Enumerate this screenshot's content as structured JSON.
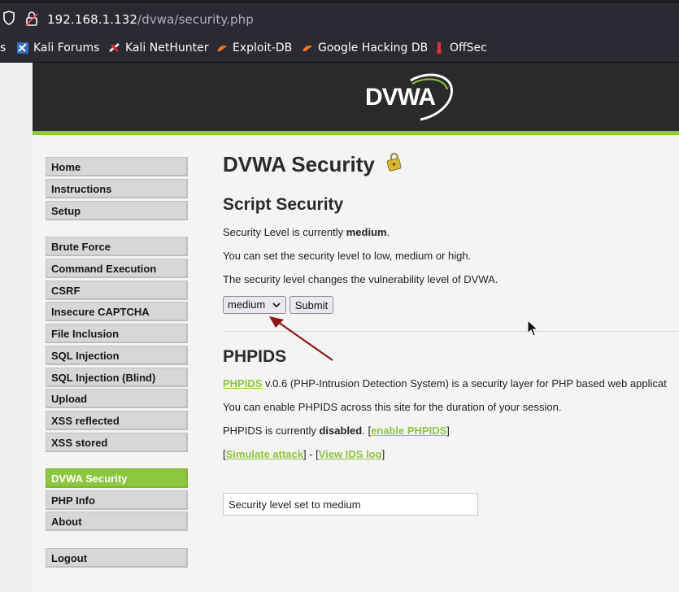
{
  "browser": {
    "url_host": "192.168.1.132",
    "url_path": "/dvwa/security.php",
    "bookmarks": [
      {
        "label": "s",
        "icon": "truncated-bookmark"
      },
      {
        "label": "Kali Forums",
        "icon": "kali-forums-icon"
      },
      {
        "label": "Kali NetHunter",
        "icon": "kali-nethunter-icon"
      },
      {
        "label": "Exploit-DB",
        "icon": "exploit-db-icon"
      },
      {
        "label": "Google Hacking DB",
        "icon": "google-hacking-db-icon"
      },
      {
        "label": "OffSec",
        "icon": "offsec-icon"
      }
    ]
  },
  "header": {
    "logo_text": "DVWA",
    "bg_color": "#2a2a2a",
    "accent_color": "#8dc63f"
  },
  "menu": {
    "group1": [
      "Home",
      "Instructions",
      "Setup"
    ],
    "group2": [
      "Brute Force",
      "Command Execution",
      "CSRF",
      "Insecure CAPTCHA",
      "File Inclusion",
      "SQL Injection",
      "SQL Injection (Blind)",
      "Upload",
      "XSS reflected",
      "XSS stored"
    ],
    "group3": [
      "DVWA Security",
      "PHP Info",
      "About"
    ],
    "group4": [
      "Logout"
    ],
    "selected": "DVWA Security"
  },
  "content": {
    "title": "DVWA Security",
    "script_security_heading": "Script Security",
    "level_prefix": "Security Level is currently ",
    "level_value": "medium",
    "level_suffix": ".",
    "set_text": "You can set the security level to low, medium or high.",
    "changes_text": "The security level changes the vulnerability level of DVWA.",
    "select_value": "medium",
    "submit_label": "Submit",
    "phpids_heading": "PHPIDS",
    "phpids_link": "PHPIDS",
    "phpids_desc": " v.0.6 (PHP-Intrusion Detection System) is a security layer for PHP based web applicat",
    "phpids_enable_text": "You can enable PHPIDS across this site for the duration of your session.",
    "phpids_status_prefix": "PHPIDS is currently ",
    "phpids_status_value": "disabled",
    "phpids_status_mid": ". [",
    "enable_link": "enable PHPIDS",
    "bracket_close": "]",
    "bracket_open": "[",
    "simulate_link": "Simulate attack",
    "sep": "] - [",
    "ids_log_link": "View IDS log",
    "message": "Security level set to medium"
  }
}
